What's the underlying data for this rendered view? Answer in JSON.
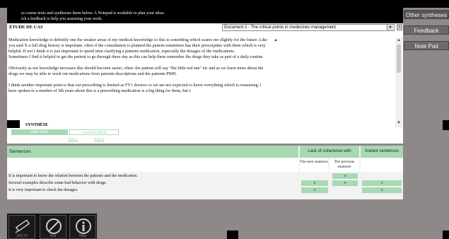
{
  "header": {
    "line1": "ss course texts and synthesise them below. A Notepad is available to plan your ideas.",
    "line2": "ick a feedback to help you assessing your work."
  },
  "right_tabs": [
    "Other syntheses",
    "Feedback",
    "Note Pad"
  ],
  "case": {
    "title": "ÉTUDE DE CAS",
    "document_select": "Document 2 - The critical points in medecines management",
    "help_label": "?",
    "paragraphs": [
      "Medication knowledge is definitly one the weaker areas of my medical knowledge so this is something which scares me slightly for the future. Like you said X a full drug history is important. often if the consultation is planned the patient sometimes has their prescriptino with them which is very helpful. If not I think it is just important to spend time clarifying a patients medication, especially the dosages of the medications.",
      "Sometimes I find it helpful to get the patient to go through there day as this can help them remember the drugs they take as part of a daily routine.",
      "Obviously as our knowledge increases this should become easier, often. the patient will say \"the little red one\" etc and as we learn more about the drugs we may be able to work out medications from patients descriptions and the patients PMH.",
      "I think another important point is that our prescribing is limited as FY1 doctors so we are not expected to know everything which is reassuring. i have spoken to a number of 5th years about this is a prescribing medication is a big thing for them, but I"
    ]
  },
  "synthesis": {
    "label": "SYNTHÈSE",
    "mode_active": "Write Mode",
    "mode_inactive": "Feedback Mode",
    "view1": "View 1",
    "view2": "View 2"
  },
  "table": {
    "col_sentences": "Sentences",
    "col_coherence": "Lack of coherence with",
    "col_irrelevant": "Irrelant sentences",
    "sub_next": "The next sentence",
    "sub_previous": "The previous sentence",
    "rows": [
      {
        "text": "It is important to know the relation between the patients and the medication.",
        "next": "",
        "prev": "x",
        "irr": ""
      },
      {
        "text": "Several examples describe some bad behavior with drugs.",
        "next": "x",
        "prev": "x",
        "irr": "x"
      },
      {
        "text": "It is very important to check the dosages.",
        "next": "x",
        "prev": "",
        "irr": "x"
      }
    ]
  },
  "bottom": {
    "counter": "30/170",
    "exit": "Exit",
    "help": "Help"
  },
  "colors": {
    "accent_green": "#a7d9b2",
    "background": "#8f8888"
  }
}
